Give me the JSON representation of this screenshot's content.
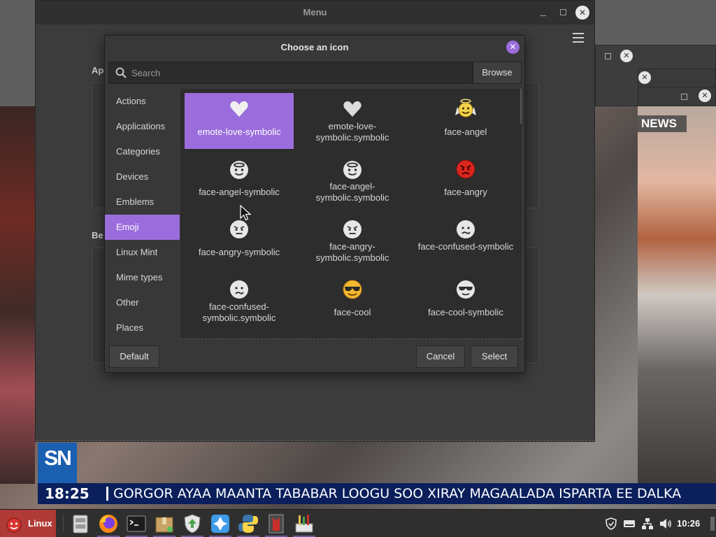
{
  "menu_window": {
    "title": "Menu",
    "section_1_label": "Ap",
    "section_2_label": "Be"
  },
  "dialog": {
    "title": "Choose an icon",
    "search_placeholder": "Search",
    "browse_label": "Browse",
    "default_label": "Default",
    "cancel_label": "Cancel",
    "select_label": "Select"
  },
  "sidebar": {
    "items": [
      {
        "label": "Actions"
      },
      {
        "label": "Applications"
      },
      {
        "label": "Categories"
      },
      {
        "label": "Devices"
      },
      {
        "label": "Emblems"
      },
      {
        "label": "Emoji"
      },
      {
        "label": "Linux Mint"
      },
      {
        "label": "Mime types"
      },
      {
        "label": "Other"
      },
      {
        "label": "Places"
      }
    ],
    "active": "Emoji"
  },
  "icons": [
    {
      "label": "emote-love-symbolic",
      "icon": "heart-icon"
    },
    {
      "label": "emote-love-symbolic.symbolic",
      "icon": "heart-icon"
    },
    {
      "label": "face-angel",
      "icon": "face-angel-icon"
    },
    {
      "label": "face-angel-symbolic",
      "icon": "face-angel-symbolic-icon"
    },
    {
      "label": "face-angel-symbolic.symbolic",
      "icon": "face-angel-symbolic-icon"
    },
    {
      "label": "face-angry",
      "icon": "face-angry-icon"
    },
    {
      "label": "face-angry-symbolic",
      "icon": "face-angry-symbolic-icon"
    },
    {
      "label": "face-angry-symbolic.symbolic",
      "icon": "face-angry-symbolic-icon"
    },
    {
      "label": "face-confused-symbolic",
      "icon": "face-confused-symbolic-icon"
    },
    {
      "label": "face-confused-symbolic.symbolic",
      "icon": "face-confused-symbolic-icon"
    },
    {
      "label": "face-cool",
      "icon": "face-cool-icon"
    },
    {
      "label": "face-cool-symbolic",
      "icon": "face-cool-symbolic-icon"
    }
  ],
  "selected_icon": "emote-love-symbolic",
  "background": {
    "news_tag": "NEWS",
    "logo_text": "SN",
    "ticker_time": "18:25",
    "ticker_text": "GORGOR AYAA MAANTA TABABAR LOOGU SOO XIRAY MAGAALADA ISPARTA EE DALKA"
  },
  "taskbar": {
    "start_label": "Linux",
    "clock": "10:26",
    "launchers": [
      "file-manager-icon",
      "firefox-icon",
      "terminal-icon",
      "archive-manager-icon",
      "update-manager-icon",
      "app-icon",
      "python-icon",
      "wardrobe-icon",
      "tools-icon"
    ],
    "tray": [
      "shield-icon",
      "keyboard-icon",
      "network-icon",
      "volume-icon"
    ]
  },
  "colors": {
    "accent": "#9b6ddc",
    "start_button": "#b03a36",
    "ticker_bg": "#0a1f5c",
    "logo_bg": "#1b5fb0"
  }
}
